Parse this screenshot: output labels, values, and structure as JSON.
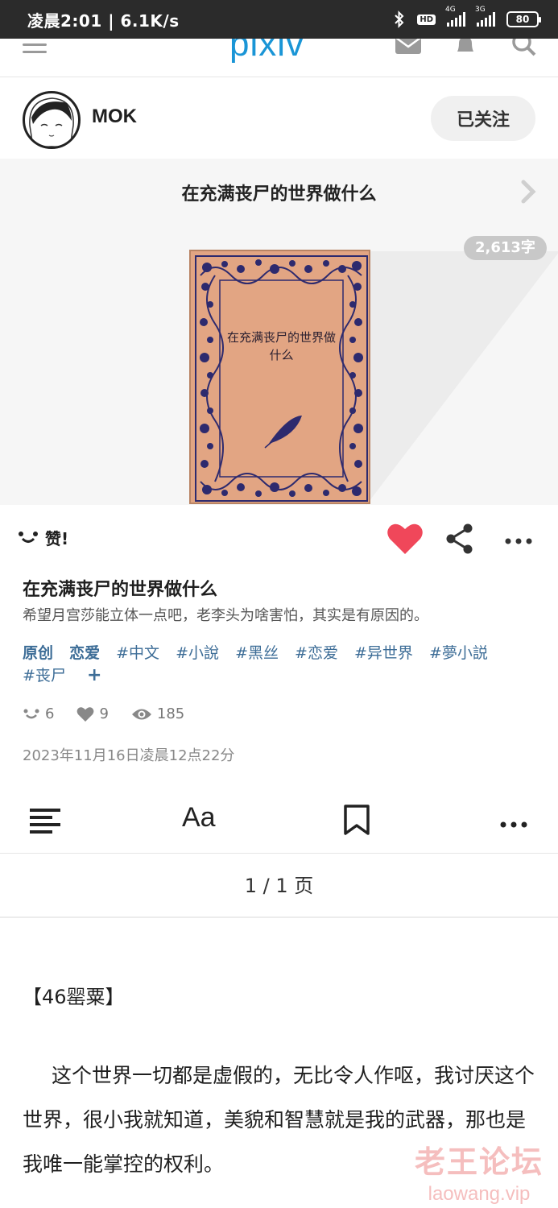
{
  "status_bar": {
    "time_speed": "凌晨2:01 | 6.1K/s",
    "hd": "HD",
    "net1": "4G",
    "net2": "3G",
    "battery": "80"
  },
  "header": {
    "logo": "pixiv",
    "icons": [
      "menu-icon",
      "mail-icon",
      "bell-icon",
      "search-icon"
    ]
  },
  "author": {
    "name": "MOK",
    "follow_label": "已关注"
  },
  "series": {
    "title": "在充满丧尸的世界做什么",
    "word_count": "2,613字"
  },
  "cover": {
    "title": "在充满丧尸的世界做什么",
    "colors": {
      "paper": "#e2a583",
      "ornament": "#2d2a6e"
    }
  },
  "actions": {
    "like_label": "赞!",
    "heart_color": "#f0475a"
  },
  "work": {
    "title": "在充满丧尸的世界做什么",
    "caption": "希望月宫莎能立体一点吧，老李头为啥害怕，其实是有原因的。",
    "tags": [
      "原创",
      "恋爱",
      "#中文",
      "#小說",
      "#黑丝",
      "#恋爱",
      "#异世界",
      "#夢小説",
      "#丧尸"
    ],
    "add_tag": "+",
    "stats": {
      "reactions": "6",
      "likes": "9",
      "views": "185"
    },
    "date": "2023年11月16日凌晨12点22分"
  },
  "reader": {
    "page_indicator": "1 / 1 页",
    "font_label": "Aa"
  },
  "content": {
    "chapter": "【46罂粟】",
    "paragraph": "这个世界一切都是虚假的，无比令人作呕，我讨厌这个世界，很小我就知道，美貌和智慧就是我的武器，那也是我唯一能掌控的权利。"
  },
  "watermark": {
    "cn": "老王论坛",
    "en": "laowang.vip"
  }
}
